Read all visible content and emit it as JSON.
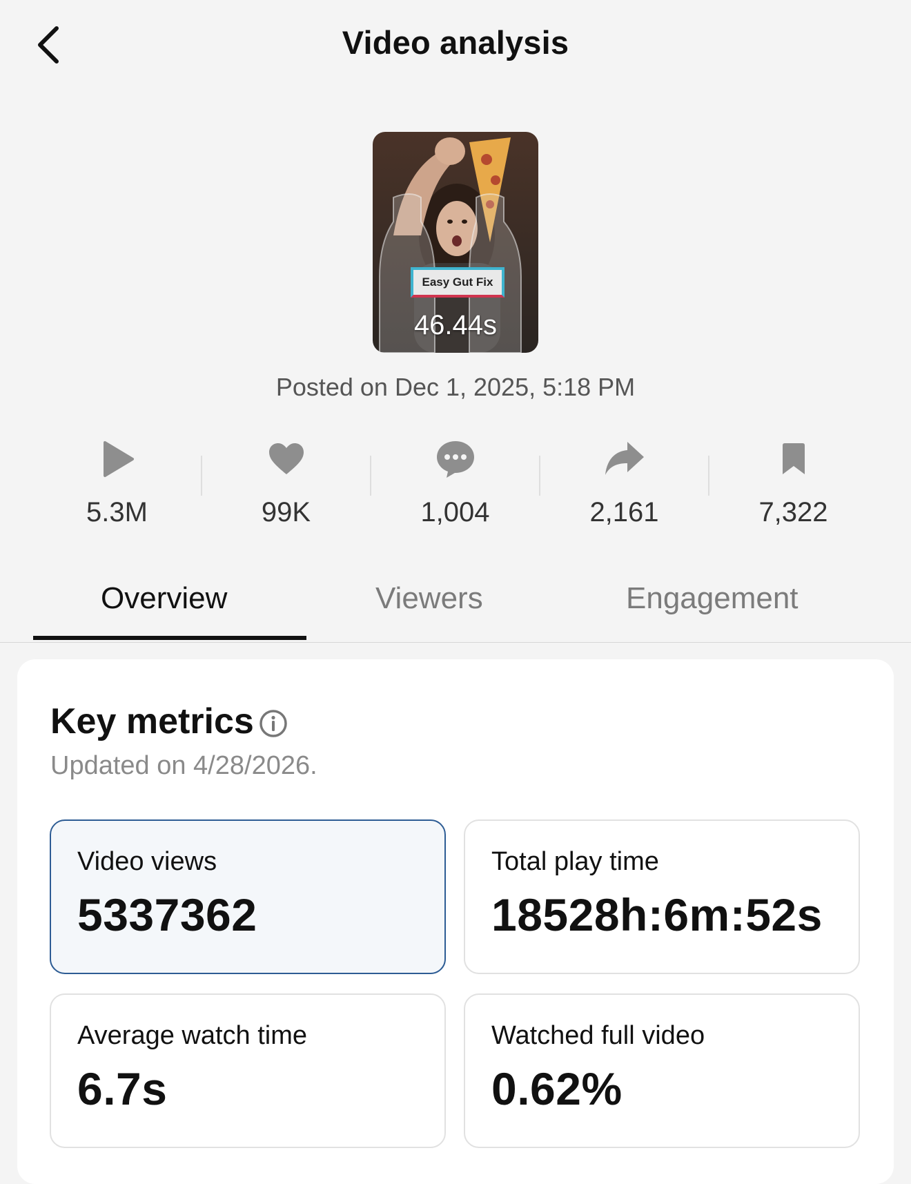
{
  "header": {
    "title": "Video analysis"
  },
  "video": {
    "caption": "Easy Gut Fix",
    "duration": "46.44s",
    "posted": "Posted on Dec 1, 2025, 5:18 PM"
  },
  "stats": [
    {
      "icon": "play-icon",
      "value": "5.3M"
    },
    {
      "icon": "heart-icon",
      "value": "99K"
    },
    {
      "icon": "comment-icon",
      "value": "1,004"
    },
    {
      "icon": "share-icon",
      "value": "2,161"
    },
    {
      "icon": "bookmark-icon",
      "value": "7,322"
    }
  ],
  "tabs": [
    {
      "label": "Overview",
      "active": true
    },
    {
      "label": "Viewers",
      "active": false
    },
    {
      "label": "Engagement",
      "active": false
    }
  ],
  "key_metrics": {
    "title": "Key metrics",
    "updated": "Updated on 4/28/2026.",
    "cards": [
      {
        "label": "Video views",
        "value": "5337362",
        "selected": true
      },
      {
        "label": "Total play time",
        "value": "18528h:6m:52s",
        "selected": false
      },
      {
        "label": "Average watch time",
        "value": "6.7s",
        "selected": false
      },
      {
        "label": "Watched full video",
        "value": "0.62%",
        "selected": false
      }
    ]
  },
  "colors": {
    "accent": "#2d5c94",
    "selected_bg": "#f4f7fa",
    "icon_gray": "#8e8e8e"
  }
}
